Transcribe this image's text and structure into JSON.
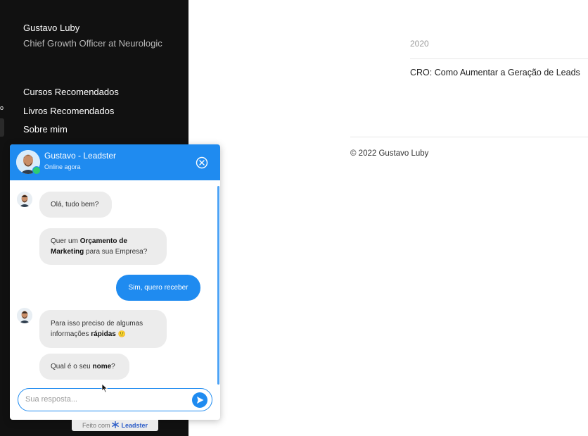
{
  "profile": {
    "name": "Gustavo Luby",
    "role": "Chief Growth Officer at Neurologic"
  },
  "nav": {
    "items": [
      "Cursos Recomendados",
      "Livros Recomendados",
      "Sobre mim"
    ]
  },
  "edge_fragment": "o",
  "content": {
    "year": "2020",
    "post_title": "CRO: Como Aumentar a Geração de Leads",
    "copyright": "© 2022 Gustavo Luby"
  },
  "chat": {
    "agent_name": "Gustavo - Leadster",
    "agent_status": "Online agora",
    "messages": {
      "m1": "Olá, tudo bem?",
      "m2_pre": "Quer um ",
      "m2_bold": "Orçamento de Marketing",
      "m2_post": " para sua Empresa?",
      "reply": "Sim, quero receber",
      "m3_pre": "Para isso preciso de algumas informações ",
      "m3_bold": "rápidas",
      "m3_emoji": "🙂",
      "m4_pre": "Qual é o seu ",
      "m4_bold": "nome",
      "m4_post": "?"
    },
    "input_placeholder": "Sua resposta...",
    "footer_prefix": "Feito com",
    "footer_brand": "Leadster"
  },
  "colors": {
    "sidebar_bg": "#111111",
    "accent": "#1f8bf0",
    "online": "#2ecc71",
    "bot_bubble": "#ececec"
  },
  "icons": [
    "close-icon",
    "send-icon",
    "online-status-icon",
    "leadster-logo-icon",
    "mouse-cursor-icon"
  ]
}
